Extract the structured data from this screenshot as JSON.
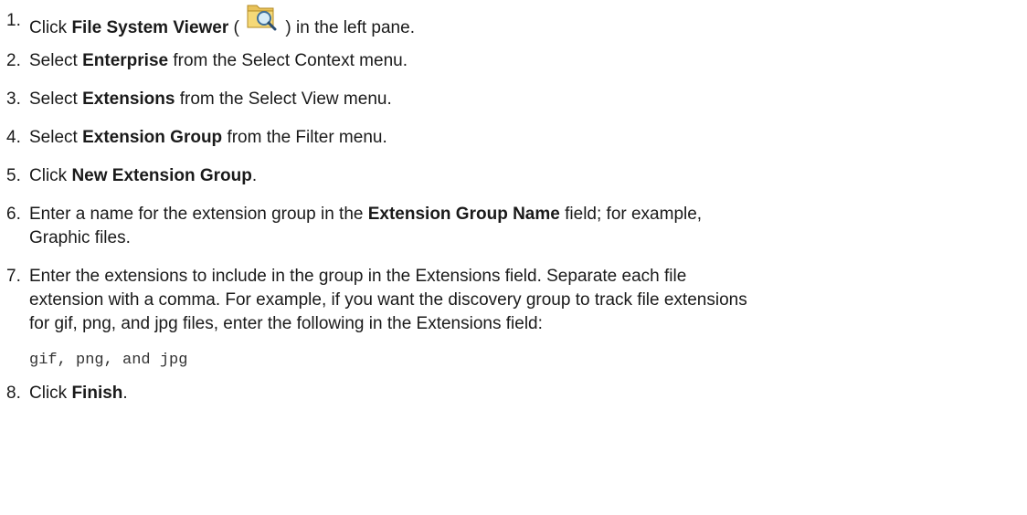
{
  "steps": [
    {
      "number": "1.",
      "before": "Click ",
      "bold": "File System Viewer",
      "after_open": " ( ",
      "icon": "file-system-viewer-icon",
      "after": " ) in the left pane."
    },
    {
      "number": "2.",
      "before": "Select ",
      "bold": "Enterprise",
      "after": " from the Select Context menu."
    },
    {
      "number": "3.",
      "before": "Select ",
      "bold": "Extensions",
      "after": " from the Select View menu."
    },
    {
      "number": "4.",
      "before": "Select ",
      "bold": "Extension Group",
      "after": " from the Filter menu."
    },
    {
      "number": "5.",
      "before": "Click ",
      "bold": "New Extension Group",
      "after": "."
    },
    {
      "number": "6.",
      "before": "Enter a name for the extension group in the ",
      "bold": "Extension Group Name",
      "after": " field; for example,",
      "line2": "Graphic files."
    },
    {
      "number": "7.",
      "line1": "Enter the extensions to include in the group in the Extensions field. Separate each file",
      "line2": "extension with a comma. For example, if you want the discovery group to track file extensions",
      "line3": "for gif, png, and jpg files, enter the following in the Extensions field:",
      "code": "gif, png, and jpg"
    },
    {
      "number": "8.",
      "before": "Click ",
      "bold": "Finish",
      "after": "."
    }
  ]
}
